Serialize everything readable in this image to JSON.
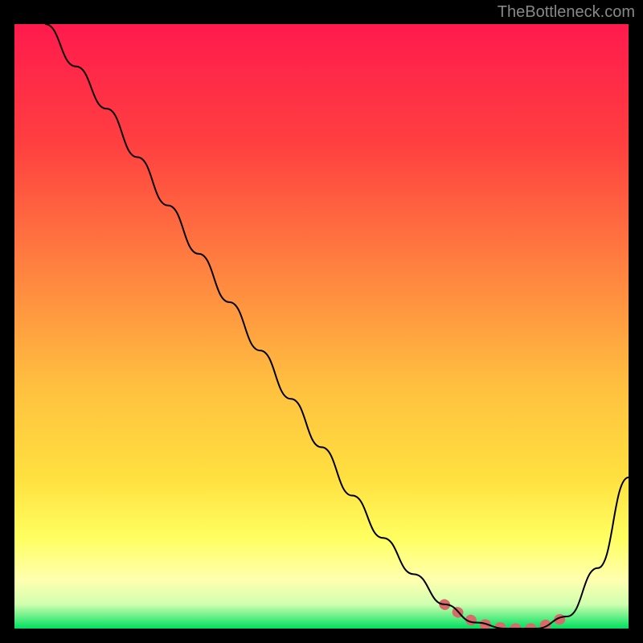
{
  "watermark": "TheBottleneck.com",
  "chart_data": {
    "type": "line",
    "title": "",
    "xlabel": "",
    "ylabel": "",
    "xlim": [
      0,
      100
    ],
    "ylim": [
      0,
      100
    ],
    "grid": false,
    "legend": false,
    "series": [
      {
        "name": "bottleneck-curve",
        "color": "#000000",
        "x": [
          5,
          10,
          15,
          20,
          25,
          30,
          35,
          40,
          45,
          50,
          55,
          60,
          65,
          70,
          75,
          80,
          85,
          90,
          95,
          100
        ],
        "y": [
          100,
          93,
          86,
          78,
          70,
          62,
          54,
          46,
          38,
          30,
          22,
          15,
          9,
          4,
          1,
          0,
          0,
          2,
          10,
          25
        ]
      }
    ],
    "highlight": {
      "name": "optimal-range",
      "color": "#d96a6a",
      "x_start": 70,
      "x_end": 90,
      "y_approx": 1
    },
    "gradient_stops": [
      {
        "offset": 0,
        "color": "#ff1a4d"
      },
      {
        "offset": 20,
        "color": "#ff4040"
      },
      {
        "offset": 40,
        "color": "#ff8040"
      },
      {
        "offset": 60,
        "color": "#ffc040"
      },
      {
        "offset": 75,
        "color": "#ffe040"
      },
      {
        "offset": 85,
        "color": "#ffff60"
      },
      {
        "offset": 92,
        "color": "#ffffb0"
      },
      {
        "offset": 96,
        "color": "#d0ffb0"
      },
      {
        "offset": 100,
        "color": "#00e060"
      }
    ]
  }
}
